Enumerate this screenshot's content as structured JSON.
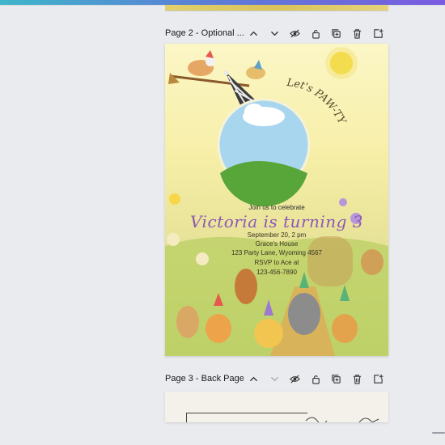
{
  "pages": [
    {
      "title": "Page 2 - Optional ...",
      "actions": [
        "chevron-up-icon",
        "chevron-down-icon",
        "eye-icon",
        "lock-icon",
        "duplicate-icon",
        "trash-icon",
        "add-page-icon"
      ],
      "invitation": {
        "tagline": "Let's PAW-TY",
        "intro": "Join us to celebrate",
        "headline": "Victoria is turning 3",
        "date": "September 20, 2 pm",
        "venue": "Grace's House",
        "address": "123 Party Lane, Wyoming 4567",
        "rsvp": "RSVP to Ace at",
        "phone": "123-456-7890"
      }
    },
    {
      "title": "Page 3 - Back Page",
      "actions": [
        "chevron-up-icon",
        "chevron-down-icon",
        "eye-icon",
        "lock-icon",
        "duplicate-icon",
        "trash-icon",
        "add-page-icon"
      ]
    }
  ],
  "colors": {
    "accent_purple": "#8d57b6",
    "sky_blue": "#a9d6ef",
    "grass_green": "#58a53a",
    "sun_yellow": "#f3dc4d"
  }
}
